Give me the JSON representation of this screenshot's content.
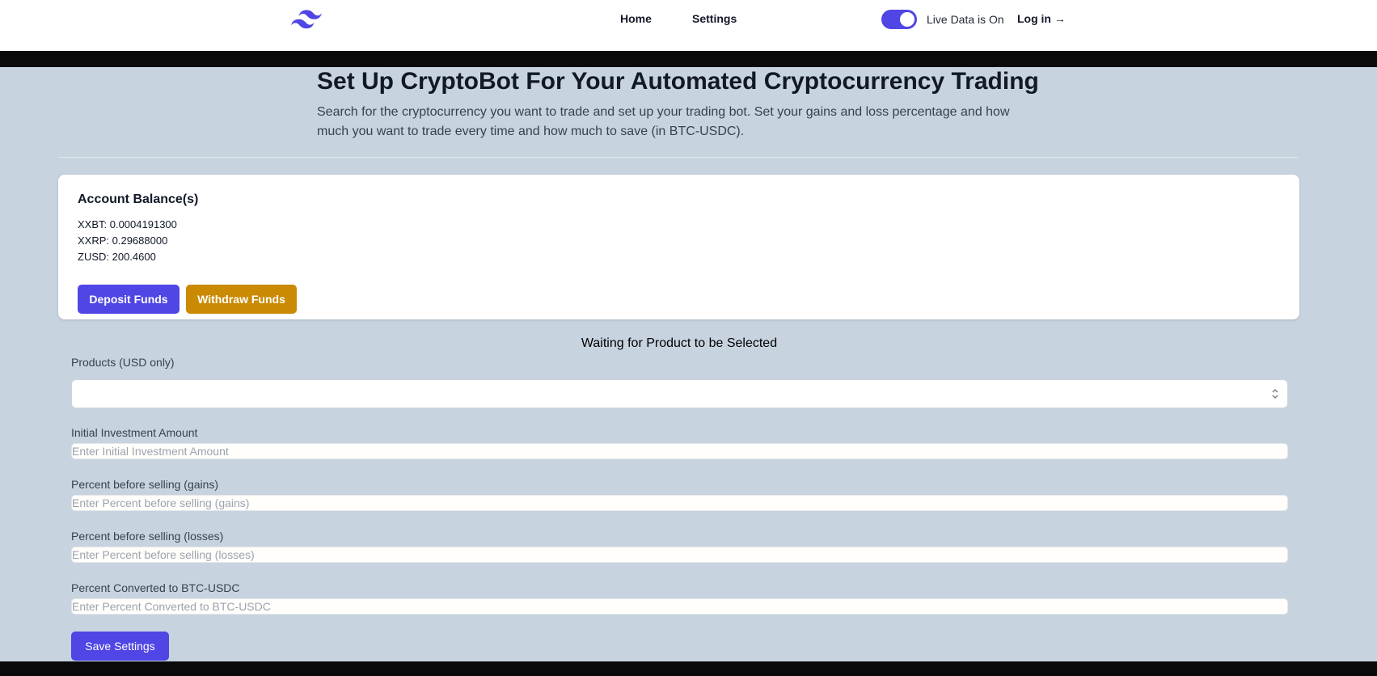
{
  "header": {
    "logo_icon": "tailwind-waves-logo",
    "nav": [
      {
        "label": "Home"
      },
      {
        "label": "Settings"
      }
    ],
    "live_data_toggle": {
      "on": true,
      "label": "Live Data is On"
    },
    "login_label": "Log in →"
  },
  "main": {
    "title": "Set Up CryptoBot For Your Automated Cryptocurrency Trading",
    "description": "Search for the cryptocurrency you want to trade and set up your trading bot. Set your gains and loss percentage and how much you want to trade every time and how much to save (in BTC-USDC)."
  },
  "balances": {
    "title": "Account Balance(s)",
    "items": [
      "XXBT: 0.0004191300",
      "XXRP: 0.29688000",
      "ZUSD: 200.4600"
    ],
    "deposit_label": "Deposit Funds",
    "withdraw_label": "Withdraw Funds"
  },
  "status": "Waiting for Product to be Selected",
  "form": {
    "products_label": "Products (USD only)",
    "products_value": "",
    "initial_investment": {
      "label": "Initial Investment Amount",
      "placeholder": "Enter Initial Investment Amount",
      "value": ""
    },
    "gains": {
      "label": "Percent before selling (gains)",
      "placeholder": "Enter Percent before selling (gains)",
      "value": ""
    },
    "losses": {
      "label": "Percent before selling (losses)",
      "placeholder": "Enter Percent before selling (losses)",
      "value": ""
    },
    "converted": {
      "label": "Percent Converted to BTC-USDC",
      "placeholder": "Enter Percent Converted to BTC-USDC",
      "value": ""
    },
    "save_label": "Save Settings"
  },
  "colors": {
    "accent": "#4f46e5",
    "warning": "#ca8a04",
    "page_bg": "#c8d3e0"
  }
}
